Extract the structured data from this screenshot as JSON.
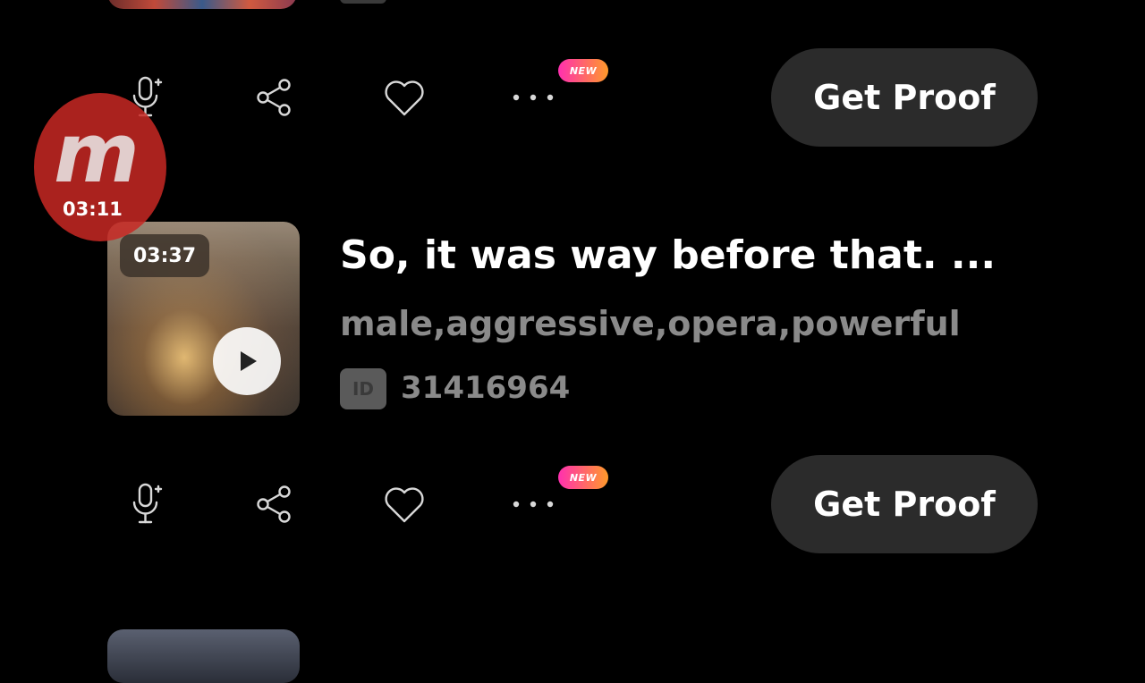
{
  "feed": {
    "actions": {
      "new_badge": "NEW",
      "get_proof_label": "Get Proof"
    },
    "track": {
      "duration": "03:37",
      "title": "So, it was way before that. ...",
      "tags": "male,aggressive,opera,powerful",
      "id_label": "ID",
      "id_value": "31416964"
    }
  },
  "floating_player": {
    "logo_letter": "m",
    "elapsed": "03:11"
  },
  "icons": {
    "mic": "microphone-plus-icon",
    "share": "share-icon",
    "like": "heart-icon",
    "more": "more-dots-icon",
    "play": "play-icon"
  },
  "colors": {
    "background": "#000000",
    "button_bg": "#2b2b2b",
    "muted_text": "#8a8a8a",
    "badge_gradient_start": "#ff2fb0",
    "badge_gradient_end": "#ff9a2a"
  }
}
